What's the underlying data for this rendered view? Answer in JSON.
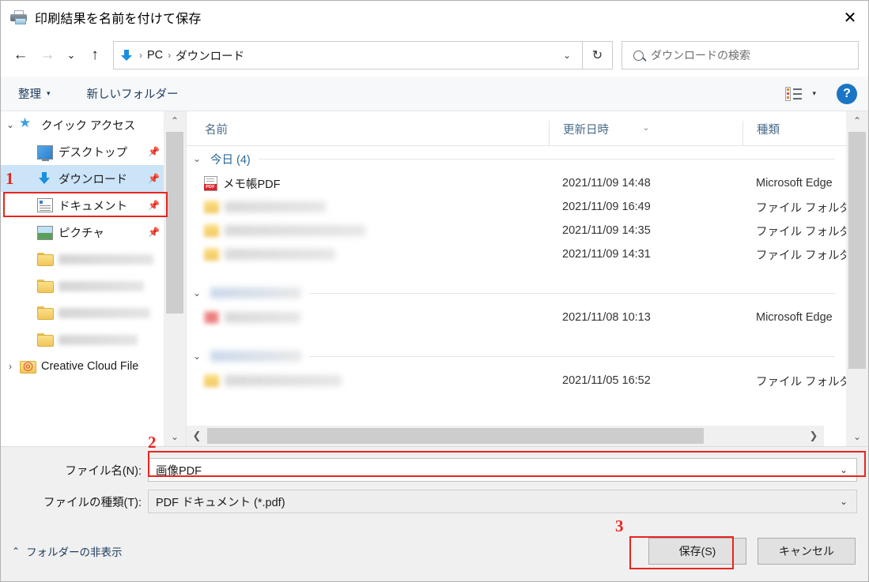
{
  "window": {
    "title": "印刷結果を名前を付けて保存",
    "title_icon": "printer-icon",
    "close_label": "✕"
  },
  "navigation": {
    "back": "←",
    "forward": "→",
    "recent": "⌄",
    "up": "↑",
    "refresh": "↻",
    "address_icon": "download-icon",
    "breadcrumbs": [
      "PC",
      "ダウンロード"
    ],
    "separator": "›",
    "dropdown_caret": "⌄"
  },
  "search": {
    "placeholder": "ダウンロードの検索",
    "icon": "search-icon"
  },
  "commandbar": {
    "organize": "整理",
    "organize_caret": "▾",
    "new_folder": "新しいフォルダー",
    "view_icon": "view-options-icon",
    "view_caret": "▾",
    "help": "?"
  },
  "sidebar": {
    "items": [
      {
        "label": "クイック アクセス",
        "icon": "star-icon",
        "twisty": "⌄",
        "indent": 0,
        "pinned": false,
        "selected": false,
        "blurred": false
      },
      {
        "label": "デスクトップ",
        "icon": "desktop-icon",
        "twisty": "",
        "indent": 1,
        "pinned": true,
        "selected": false,
        "blurred": false
      },
      {
        "label": "ダウンロード",
        "icon": "download-icon",
        "twisty": "",
        "indent": 1,
        "pinned": true,
        "selected": true,
        "blurred": false
      },
      {
        "label": "ドキュメント",
        "icon": "document-icon",
        "twisty": "",
        "indent": 1,
        "pinned": true,
        "selected": false,
        "blurred": false
      },
      {
        "label": "ピクチャ",
        "icon": "pictures-icon",
        "twisty": "",
        "indent": 1,
        "pinned": true,
        "selected": false,
        "blurred": false
      },
      {
        "label": "",
        "icon": "folder-icon",
        "twisty": "",
        "indent": 1,
        "pinned": false,
        "selected": false,
        "blurred": true,
        "blur_width": 120
      },
      {
        "label": "",
        "icon": "folder-icon",
        "twisty": "",
        "indent": 1,
        "pinned": false,
        "selected": false,
        "blurred": true,
        "blur_width": 108
      },
      {
        "label": "",
        "icon": "folder-icon",
        "twisty": "",
        "indent": 1,
        "pinned": false,
        "selected": false,
        "blurred": true,
        "blur_width": 116
      },
      {
        "label": "",
        "icon": "folder-icon",
        "twisty": "",
        "indent": 1,
        "pinned": false,
        "selected": false,
        "blurred": true,
        "blur_width": 100
      },
      {
        "label": "Creative Cloud File",
        "icon": "creative-cloud-folder-icon",
        "twisty": "›",
        "indent": 0,
        "pinned": false,
        "selected": false,
        "blurred": false
      }
    ],
    "scroll_up": "⌃",
    "scroll_down": "⌄"
  },
  "filelist": {
    "columns": [
      {
        "key": "name",
        "label": "名前",
        "sorted": false
      },
      {
        "key": "date",
        "label": "更新日時",
        "sorted": true,
        "sort_caret": "⌄"
      },
      {
        "key": "type",
        "label": "種類",
        "sorted": false
      }
    ],
    "groups": [
      {
        "header": "今日 (4)",
        "blurred_header": false,
        "collapse_icon": "⌄",
        "rows": [
          {
            "name": "メモ帳PDF",
            "icon": "pdf-icon",
            "date": "2021/11/09 14:48",
            "type": "Microsoft Edge ",
            "blurred": false
          },
          {
            "name": "",
            "icon": "folder-icon",
            "date": "2021/11/09 16:49",
            "type": "ファイル フォルダー",
            "blurred": true,
            "blur_width": 128
          },
          {
            "name": "",
            "icon": "folder-icon",
            "date": "2021/11/09 14:35",
            "type": "ファイル フォルダー",
            "blurred": true,
            "blur_width": 178
          },
          {
            "name": "",
            "icon": "folder-icon",
            "date": "2021/11/09 14:31",
            "type": "ファイル フォルダー",
            "blurred": true,
            "blur_width": 140
          }
        ]
      },
      {
        "header": "",
        "blurred_header": true,
        "collapse_icon": "⌄",
        "rows": [
          {
            "name": "",
            "icon": "app-icon",
            "date": "2021/11/08 10:13",
            "type": "Microsoft Edge ",
            "blurred": true,
            "blur_width": 96
          }
        ]
      },
      {
        "header": "",
        "blurred_header": true,
        "collapse_icon": "⌄",
        "rows": [
          {
            "name": "",
            "icon": "folder-icon",
            "date": "2021/11/05 16:52",
            "type": "ファイル フォルダー",
            "blurred": true,
            "blur_width": 148
          }
        ]
      }
    ],
    "scroll_left": "❮",
    "scroll_right": "❯",
    "scroll_up": "⌃",
    "scroll_down": "⌄"
  },
  "form": {
    "filename_label": "ファイル名(N):",
    "filename_value": "画像PDF",
    "filename_caret": "⌄",
    "filetype_label": "ファイルの種類(T):",
    "filetype_value": "PDF ドキュメント (*.pdf)",
    "filetype_caret": "⌄"
  },
  "footer": {
    "hide_folders": "フォルダーの非表示",
    "hide_folders_chev": "⌃",
    "save": "保存(S)",
    "cancel": "キャンセル"
  },
  "annotations": {
    "markers": [
      {
        "number": "1",
        "target": "sidebar-item-downloads"
      },
      {
        "number": "2",
        "target": "filename-input"
      },
      {
        "number": "3",
        "target": "save-button"
      }
    ],
    "color": "#e8251f"
  }
}
